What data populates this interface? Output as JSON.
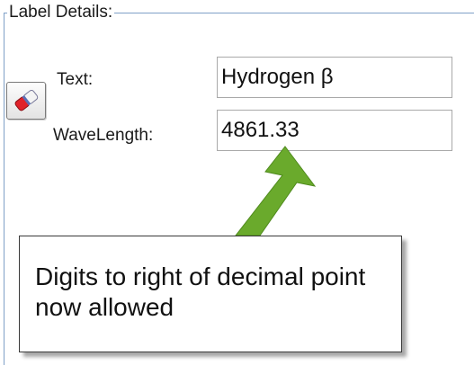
{
  "group": {
    "title": "Label Details:"
  },
  "clear_button": {
    "icon": "eraser-icon"
  },
  "fields": {
    "text_label": "Text:",
    "text_value": "Hydrogen β",
    "wavelength_label": "WaveLength:",
    "wavelength_value": "4861.33"
  },
  "callout": {
    "text": "Digits to right of decimal point now allowed"
  },
  "colors": {
    "arrow": "#6aaa2c",
    "group_border": "#7fa0c8",
    "input_border": "#a9a9a9"
  }
}
